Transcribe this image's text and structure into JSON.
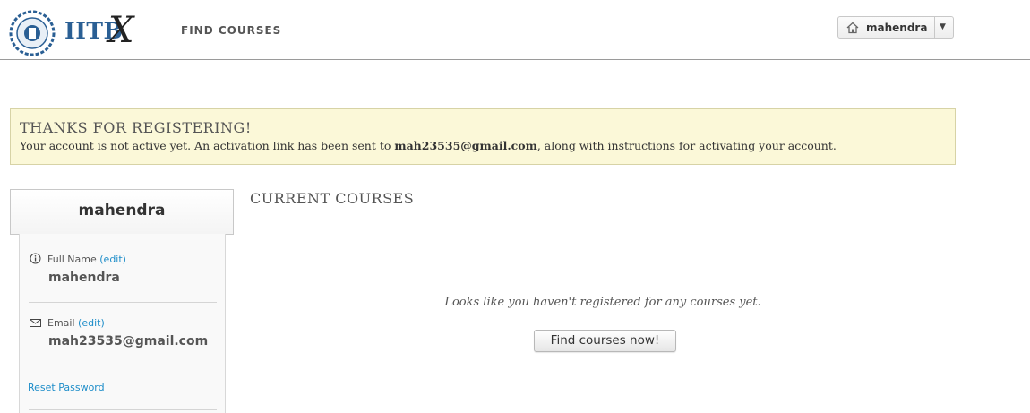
{
  "header": {
    "logo_text": "IITB",
    "logo_x": "X",
    "nav": {
      "find_courses": "FIND COURSES"
    },
    "user_menu": {
      "username": "mahendra",
      "caret": "▼"
    }
  },
  "banner": {
    "title": "THANKS FOR REGISTERING!",
    "message_before": "Your account is not active yet. An activation link has been sent to ",
    "email": "mah23535@gmail.com",
    "message_after": ", along with instructions for activating your account."
  },
  "profile": {
    "username": "mahendra",
    "full_name_label": "Full Name",
    "full_name_edit": "(edit)",
    "full_name": "mahendra",
    "email_label": "Email",
    "email_edit": "(edit)",
    "email": "mah23535@gmail.com",
    "reset_password": "Reset Password"
  },
  "courses": {
    "title": "CURRENT COURSES",
    "empty_message": "Looks like you haven't registered for any courses yet.",
    "find_button": "Find courses now!"
  },
  "colors": {
    "link": "#1d8dc9",
    "banner_bg": "#fbf8d8",
    "logo_blue": "#2a5f94"
  }
}
